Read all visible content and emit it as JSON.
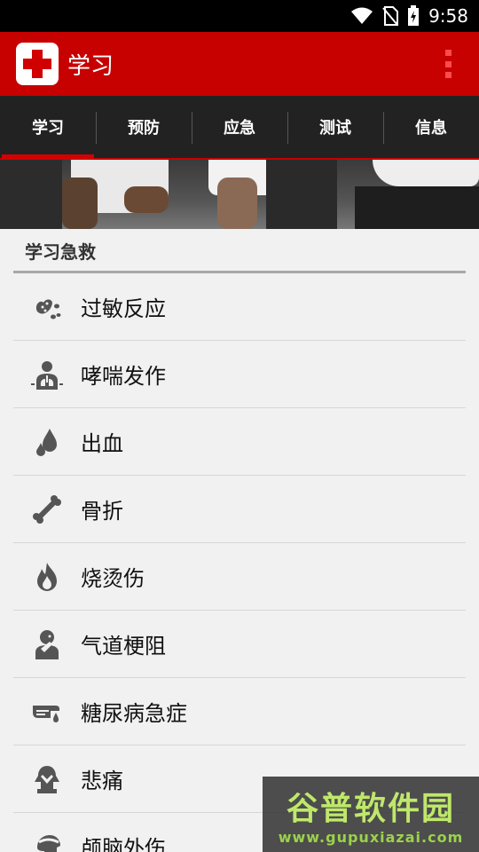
{
  "status": {
    "time": "9:58",
    "icons": [
      "wifi-icon",
      "no-sim-icon",
      "battery-charging-icon"
    ]
  },
  "appbar": {
    "title": "学习",
    "logo": "red-cross-logo",
    "menu_icon": "overflow-menu-icon"
  },
  "tabs": [
    {
      "label": "学习",
      "active": true
    },
    {
      "label": "预防",
      "active": false
    },
    {
      "label": "应急",
      "active": false
    },
    {
      "label": "测试",
      "active": false
    },
    {
      "label": "信息",
      "active": false
    }
  ],
  "section": {
    "title": "学习急救"
  },
  "items": [
    {
      "label": "过敏反应",
      "icon": "peanut-icon"
    },
    {
      "label": "哮喘发作",
      "icon": "lungs-icon"
    },
    {
      "label": "出血",
      "icon": "blood-drop-icon"
    },
    {
      "label": "骨折",
      "icon": "bone-icon"
    },
    {
      "label": "烧烫伤",
      "icon": "flame-icon"
    },
    {
      "label": "气道梗阻",
      "icon": "choking-icon"
    },
    {
      "label": "糖尿病急症",
      "icon": "diabetes-icon"
    },
    {
      "label": "悲痛",
      "icon": "grief-icon"
    },
    {
      "label": "颅脑外伤",
      "icon": "head-injury-icon"
    }
  ],
  "watermark": {
    "main": "谷普软件园",
    "url": "www.gupuxiazai.com"
  },
  "colors": {
    "primary": "#c70000",
    "tab_bg": "#222222",
    "accent": "#d40000"
  }
}
